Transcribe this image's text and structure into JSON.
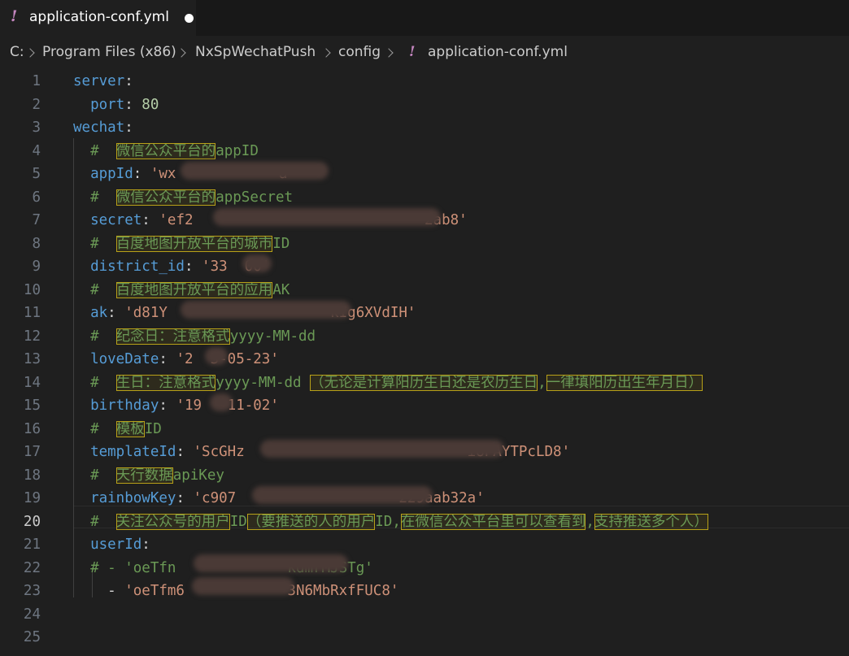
{
  "tab": {
    "icon": "yaml-exclamation-icon",
    "icon_glyph": "!",
    "filename": "application-conf.yml",
    "modified_indicator": "unsaved-dot"
  },
  "breadcrumbs": [
    "C:",
    "Program Files (x86)",
    "NxSpWechatPush",
    "config",
    "!",
    "application-conf.yml"
  ],
  "active_line": 20,
  "lines": [
    {
      "n": "1",
      "parts": [
        {
          "t": "server",
          "c": "k"
        },
        {
          "t": ":",
          "c": "p"
        }
      ]
    },
    {
      "n": "2",
      "parts": [
        {
          "t": "  port",
          "c": "k"
        },
        {
          "t": ": ",
          "c": "p"
        },
        {
          "t": "80",
          "c": "v"
        }
      ]
    },
    {
      "n": "3",
      "parts": [
        {
          "t": "wechat",
          "c": "k"
        },
        {
          "t": ":",
          "c": "p"
        }
      ]
    },
    {
      "n": "4",
      "parts": [
        {
          "t": "  #  ",
          "c": "c"
        },
        {
          "t": "微信公众平台的",
          "c": "c",
          "hl": true
        },
        {
          "t": "appID",
          "c": "c"
        }
      ]
    },
    {
      "n": "5",
      "parts": [
        {
          "t": "  appId",
          "c": "k"
        },
        {
          "t": ": ",
          "c": "p"
        },
        {
          "t": "'wx",
          "c": "s"
        },
        {
          "t": "            ",
          "c": "s"
        },
        {
          "t": "a'",
          "c": "s"
        }
      ]
    },
    {
      "n": "6",
      "parts": [
        {
          "t": "  #  ",
          "c": "c"
        },
        {
          "t": "微信公众平台的",
          "c": "c",
          "hl": true
        },
        {
          "t": "appSecret",
          "c": "c"
        }
      ]
    },
    {
      "n": "7",
      "parts": [
        {
          "t": "  secret",
          "c": "k"
        },
        {
          "t": ": ",
          "c": "p"
        },
        {
          "t": "'ef2",
          "c": "s"
        },
        {
          "t": "                           ",
          "c": "s"
        },
        {
          "t": "2ab8'",
          "c": "s"
        }
      ]
    },
    {
      "n": "8",
      "parts": [
        {
          "t": "  #  ",
          "c": "c"
        },
        {
          "t": "百度地图开放平台的城市",
          "c": "c",
          "hl": true
        },
        {
          "t": "ID",
          "c": "c"
        }
      ]
    },
    {
      "n": "9",
      "parts": [
        {
          "t": "  district_id",
          "c": "k"
        },
        {
          "t": ": ",
          "c": "p"
        },
        {
          "t": "'33",
          "c": "s"
        },
        {
          "t": "  ",
          "c": "s"
        },
        {
          "t": "00'",
          "c": "s"
        }
      ]
    },
    {
      "n": "10",
      "parts": [
        {
          "t": "  #  ",
          "c": "c"
        },
        {
          "t": "百度地图开放平台的应用",
          "c": "c",
          "hl": true
        },
        {
          "t": "AK",
          "c": "c"
        }
      ]
    },
    {
      "n": "11",
      "parts": [
        {
          "t": "  ak",
          "c": "k"
        },
        {
          "t": ": ",
          "c": "p"
        },
        {
          "t": "'d81Y",
          "c": "s"
        },
        {
          "t": "                   ",
          "c": "s"
        },
        {
          "t": "kIg6XVdIH'",
          "c": "s"
        }
      ]
    },
    {
      "n": "12",
      "parts": [
        {
          "t": "  #  ",
          "c": "c"
        },
        {
          "t": "纪念日：注意格式",
          "c": "c",
          "hl": true
        },
        {
          "t": "yyyy-MM-dd",
          "c": "c"
        }
      ]
    },
    {
      "n": "13",
      "parts": [
        {
          "t": "  loveDate",
          "c": "k"
        },
        {
          "t": ": ",
          "c": "p"
        },
        {
          "t": "'2",
          "c": "s"
        },
        {
          "t": "  ",
          "c": "s"
        },
        {
          "t": "3-05-23'",
          "c": "s"
        }
      ]
    },
    {
      "n": "14",
      "parts": [
        {
          "t": "  #  ",
          "c": "c"
        },
        {
          "t": "生日：注意格式",
          "c": "c",
          "hl": true
        },
        {
          "t": "yyyy-MM-dd ",
          "c": "c"
        },
        {
          "t": "（无论是计算阳历生日还是农历生日",
          "c": "c",
          "hl": true
        },
        {
          "t": ",",
          "c": "c"
        },
        {
          "t": "一律填阳历出生年月日）",
          "c": "c",
          "hl": true
        }
      ]
    },
    {
      "n": "15",
      "parts": [
        {
          "t": "  birthday",
          "c": "k"
        },
        {
          "t": ": ",
          "c": "p"
        },
        {
          "t": "'19",
          "c": "s"
        },
        {
          "t": "  ",
          "c": "s"
        },
        {
          "t": "-11-02'",
          "c": "s"
        }
      ]
    },
    {
      "n": "16",
      "parts": [
        {
          "t": "  #  ",
          "c": "c"
        },
        {
          "t": "模板",
          "c": "c",
          "hl": true
        },
        {
          "t": "ID",
          "c": "c"
        }
      ]
    },
    {
      "n": "17",
      "parts": [
        {
          "t": "  templateId",
          "c": "k"
        },
        {
          "t": ": ",
          "c": "p"
        },
        {
          "t": "'ScGHz",
          "c": "s"
        },
        {
          "t": "                          ",
          "c": "s"
        },
        {
          "t": "i8PAYTPcLD8'",
          "c": "s"
        }
      ]
    },
    {
      "n": "18",
      "parts": [
        {
          "t": "  #  ",
          "c": "c"
        },
        {
          "t": "天行数据",
          "c": "c",
          "hl": true
        },
        {
          "t": "apiKey",
          "c": "c"
        }
      ]
    },
    {
      "n": "19",
      "parts": [
        {
          "t": "  rainbowKey",
          "c": "k"
        },
        {
          "t": ": ",
          "c": "p"
        },
        {
          "t": "'c907",
          "c": "s"
        },
        {
          "t": "                   ",
          "c": "s"
        },
        {
          "t": "229aab32a'",
          "c": "s"
        }
      ]
    },
    {
      "n": "20",
      "parts": [
        {
          "t": "  #  ",
          "c": "c"
        },
        {
          "t": "关注公众号的用户",
          "c": "c",
          "hl": true
        },
        {
          "t": "ID",
          "c": "c"
        },
        {
          "t": "（要推送的人的用户",
          "c": "c",
          "hl": true
        },
        {
          "t": "ID,",
          "c": "c"
        },
        {
          "t": "在微信公众平台里可以查看到",
          "c": "c",
          "hl": true
        },
        {
          "t": ",",
          "c": "c"
        },
        {
          "t": "支持推送多个人）",
          "c": "c",
          "hl": true
        }
      ]
    },
    {
      "n": "21",
      "parts": [
        {
          "t": "  userId",
          "c": "k"
        },
        {
          "t": ":",
          "c": "p"
        }
      ]
    },
    {
      "n": "22",
      "parts": [
        {
          "t": "  # - 'oeTfn",
          "c": "c"
        },
        {
          "t": "             ",
          "c": "c"
        },
        {
          "t": "kdmrMJSTg'",
          "c": "c"
        }
      ]
    },
    {
      "n": "23",
      "parts": [
        {
          "t": "    - ",
          "c": "p"
        },
        {
          "t": "'oeTfm6",
          "c": "s"
        },
        {
          "t": "            ",
          "c": "s"
        },
        {
          "t": "3N6MbRxfFUC8'",
          "c": "s"
        }
      ]
    },
    {
      "n": "24",
      "parts": []
    },
    {
      "n": "25",
      "parts": []
    }
  ]
}
